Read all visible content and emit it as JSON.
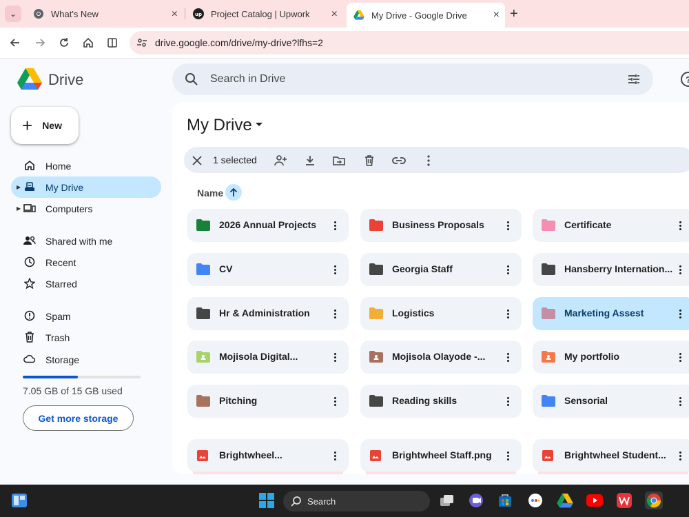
{
  "browser": {
    "tabs": [
      {
        "title": "What's New",
        "icon": "chrome-icon",
        "active": false
      },
      {
        "title": "Project Catalog | Upwork",
        "icon": "upwork-icon",
        "active": false
      },
      {
        "title": "My Drive - Google Drive",
        "icon": "drive-icon",
        "active": true
      }
    ],
    "url": "drive.google.com/drive/my-drive?lfhs=2"
  },
  "header": {
    "app_name": "Drive",
    "search_placeholder": "Search in Drive"
  },
  "sidebar": {
    "new_label": "New",
    "items": [
      {
        "label": "Home",
        "icon": "home-icon"
      },
      {
        "label": "My Drive",
        "icon": "my-drive-icon",
        "active": true
      },
      {
        "label": "Computers",
        "icon": "computers-icon"
      },
      {
        "label": "Shared with me",
        "icon": "shared-icon"
      },
      {
        "label": "Recent",
        "icon": "clock-icon"
      },
      {
        "label": "Starred",
        "icon": "star-icon"
      },
      {
        "label": "Spam",
        "icon": "spam-icon"
      },
      {
        "label": "Trash",
        "icon": "trash-icon"
      },
      {
        "label": "Storage",
        "icon": "cloud-icon"
      }
    ],
    "storage_used_fraction": 0.47,
    "storage_text": "7.05 GB of 15 GB used",
    "get_storage_label": "Get more storage"
  },
  "main": {
    "title": "My Drive",
    "selection_text": "1 selected",
    "sort_label": "Name",
    "folders": [
      {
        "name": "2026 Annual Projects",
        "color": "#188038",
        "type": "folder"
      },
      {
        "name": "Business Proposals",
        "color": "#ea4335",
        "type": "folder"
      },
      {
        "name": "Certificate",
        "color": "#f48fb1",
        "type": "folder"
      },
      {
        "name": "CV",
        "color": "#4285f4",
        "type": "folder"
      },
      {
        "name": "Georgia Staff",
        "color": "#444746",
        "type": "folder"
      },
      {
        "name": "Hansberry Internation...",
        "color": "#444746",
        "type": "folder"
      },
      {
        "name": "Hr & Administration",
        "color": "#444746",
        "type": "folder"
      },
      {
        "name": "Logistics",
        "color": "#f6ad35",
        "type": "folder"
      },
      {
        "name": "Marketing Assest",
        "color": "#c48fa6",
        "type": "folder",
        "selected": true
      },
      {
        "name": "Mojisola Digital...",
        "color": "#a8d36b",
        "type": "shared-folder"
      },
      {
        "name": "Mojisola Olayode -...",
        "color": "#a9725e",
        "type": "shared-folder"
      },
      {
        "name": "My portfolio",
        "color": "#f4794a",
        "type": "shared-folder"
      },
      {
        "name": "Pitching",
        "color": "#a9725e",
        "type": "folder"
      },
      {
        "name": "Reading skills",
        "color": "#444746",
        "type": "folder"
      },
      {
        "name": "Sensorial",
        "color": "#4285f4",
        "type": "folder"
      }
    ],
    "files": [
      {
        "name": "Brightwheel...",
        "color": "#ea4335",
        "type": "image"
      },
      {
        "name": "Brightwheel Staff.png",
        "color": "#ea4335",
        "type": "image"
      },
      {
        "name": "Brightwheel Student...",
        "color": "#ea4335",
        "type": "image"
      }
    ]
  },
  "taskbar": {
    "search_label": "Search"
  }
}
